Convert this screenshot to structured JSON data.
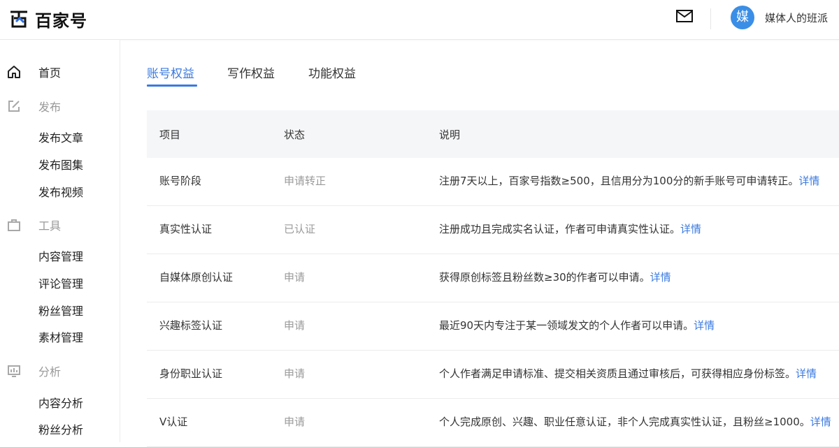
{
  "header": {
    "logo_text": "百家号",
    "avatar_char": "媒",
    "user_name": "媒体人的班派"
  },
  "sidebar": {
    "home": "首页",
    "publish": {
      "label": "发布",
      "items": [
        "发布文章",
        "发布图集",
        "发布视频"
      ]
    },
    "tools": {
      "label": "工具",
      "items": [
        "内容管理",
        "评论管理",
        "粉丝管理",
        "素材管理"
      ]
    },
    "analysis": {
      "label": "分析",
      "items": [
        "内容分析",
        "粉丝分析"
      ]
    }
  },
  "tabs": [
    "账号权益",
    "写作权益",
    "功能权益"
  ],
  "table": {
    "headers": [
      "项目",
      "状态",
      "说明"
    ],
    "detail_link": "详情",
    "rows": [
      {
        "item": "账号阶段",
        "status": "申请转正",
        "desc": "注册7天以上，百家号指数≥500，且信用分为100分的新手账号可申请转正。",
        "link": "详情"
      },
      {
        "item": "真实性认证",
        "status": "已认证",
        "desc": "注册成功且完成实名认证，作者可申请真实性认证。",
        "link": "详情"
      },
      {
        "item": "自媒体原创认证",
        "status": "申请",
        "desc": "获得原创标签且粉丝数≥30的作者可以申请。",
        "link": "详情"
      },
      {
        "item": "兴趣标签认证",
        "status": "申请",
        "desc": "最近90天内专注于某一领域发文的个人作者可以申请。",
        "link": "详情"
      },
      {
        "item": "身份职业认证",
        "status": "申请",
        "desc": "个人作者满足申请标准、提交相关资质且通过审核后，可获得相应身份标签。",
        "link": "详情"
      },
      {
        "item": "V认证",
        "status": "申请",
        "desc": "个人完成原创、兴趣、职业任意认证，非个人完成真实性认证，且粉丝≥1000。",
        "link": "详情"
      }
    ]
  },
  "colors": {
    "accent": "#3a7ae0",
    "avatar": "#3a8ee6",
    "muted": "#9a9a9a",
    "section_gray": "#999999"
  },
  "icons": [
    "logo-mark",
    "mail-icon",
    "home-icon",
    "edit-icon",
    "briefcase-icon",
    "chart-icon"
  ]
}
